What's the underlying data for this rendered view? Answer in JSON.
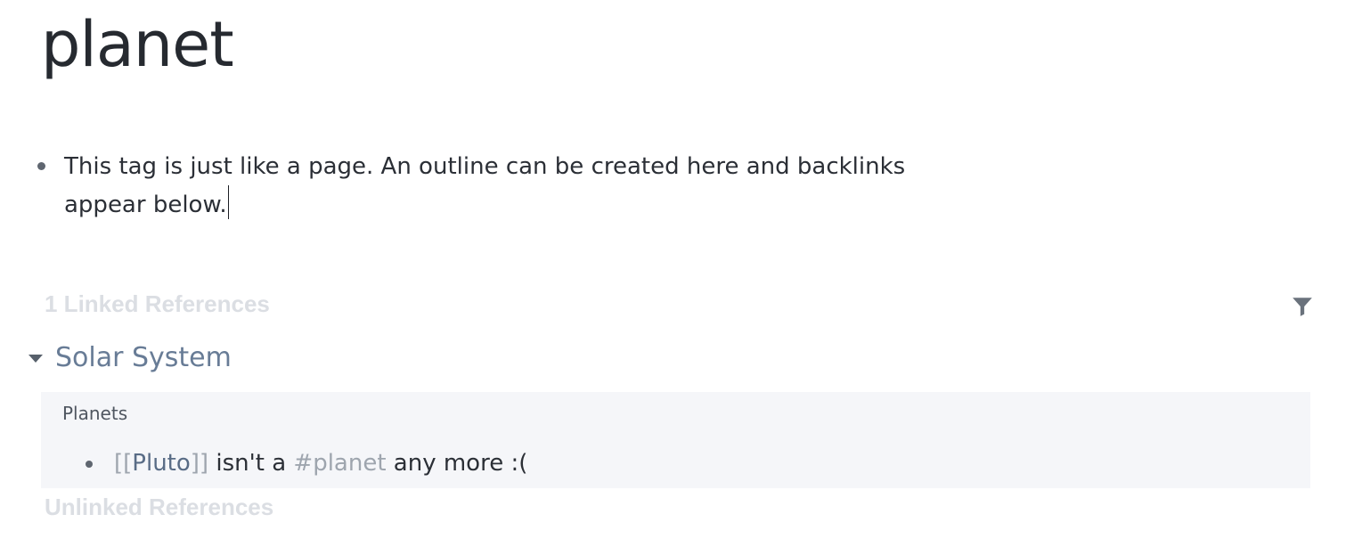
{
  "page": {
    "title": "planet"
  },
  "block": {
    "text": "This tag is just like a page. An outline can be created here and backlinks appear below."
  },
  "linked_references": {
    "heading": "1 Linked References",
    "filter_icon": "filter-icon",
    "groups": [
      {
        "page_title": "Solar System",
        "breadcrumb": "Planets",
        "block": {
          "bracket_open": "[[",
          "link": "Pluto",
          "bracket_close": "]]",
          "text_middle": " isn't a ",
          "tag": "#planet",
          "text_end": " any more :("
        }
      }
    ]
  },
  "unlinked_references": {
    "heading": "Unlinked References"
  },
  "colors": {
    "heading_muted": "#dbdee3",
    "page_ref": "#687c96",
    "card_bg": "#f5f6f9",
    "link_bracket": "#9ea5ae"
  }
}
